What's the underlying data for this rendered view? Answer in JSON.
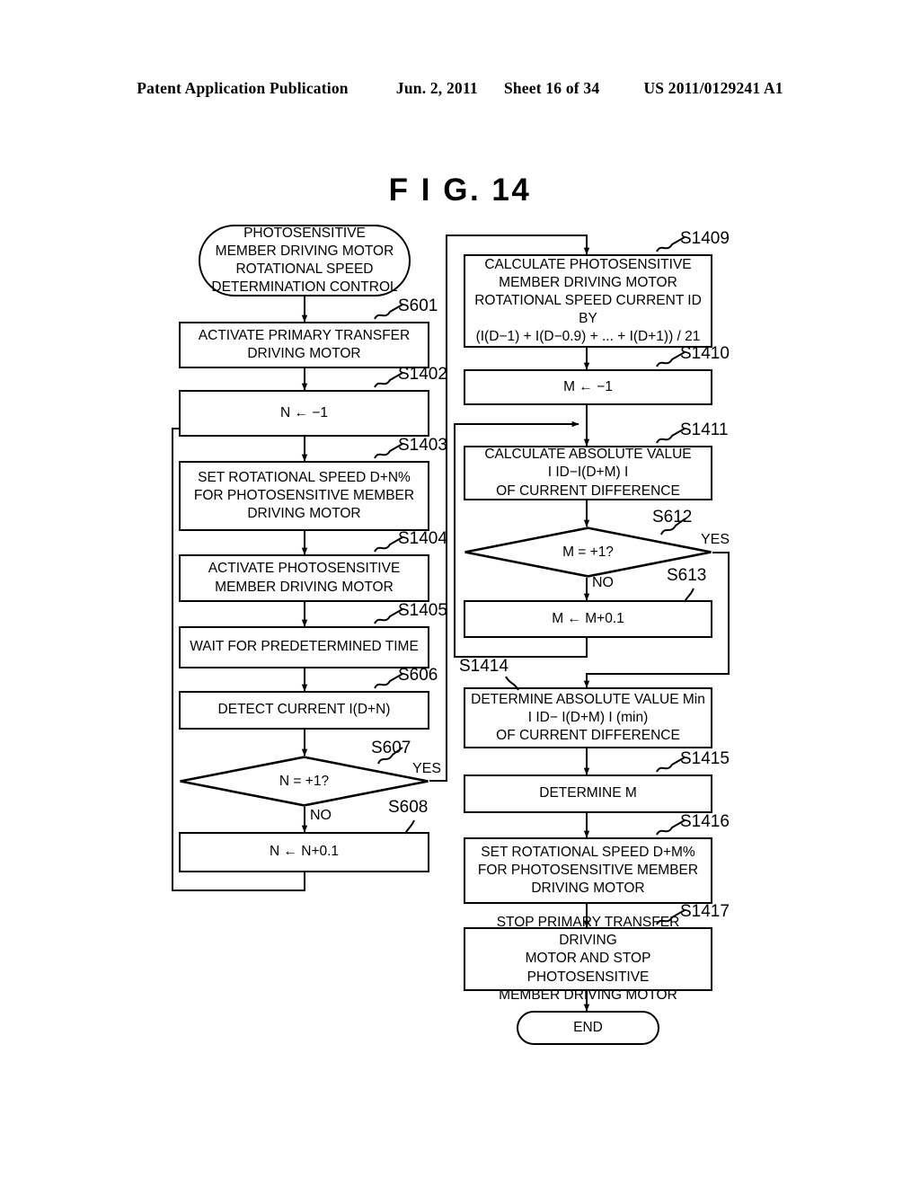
{
  "header": {
    "publication": "Patent Application Publication",
    "date": "Jun. 2, 2011",
    "sheet": "Sheet 16 of 34",
    "number": "US 2011/0129241 A1"
  },
  "figure": {
    "title": "F I G.  14"
  },
  "flowchart": {
    "start": {
      "id": "start",
      "label": "PHOTOSENSITIVE\nMEMBER DRIVING MOTOR\nROTATIONAL SPEED\nDETERMINATION CONTROL"
    },
    "end": {
      "id": "end",
      "label": "END"
    },
    "steps": [
      {
        "ref": "S601",
        "type": "process",
        "label": "ACTIVATE PRIMARY TRANSFER\nDRIVING MOTOR"
      },
      {
        "ref": "S1402",
        "type": "process",
        "label": "N ← −1"
      },
      {
        "ref": "S1403",
        "type": "process",
        "label": "SET ROTATIONAL SPEED D+N%\nFOR PHOTOSENSITIVE MEMBER\nDRIVING MOTOR"
      },
      {
        "ref": "S1404",
        "type": "process",
        "label": "ACTIVATE PHOTOSENSITIVE\nMEMBER DRIVING MOTOR"
      },
      {
        "ref": "S1405",
        "type": "process",
        "label": "WAIT FOR PREDETERMINED TIME"
      },
      {
        "ref": "S606",
        "type": "process",
        "label": "DETECT CURRENT I(D+N)"
      },
      {
        "ref": "S607",
        "type": "decision",
        "label": "N = +1?",
        "yes": "YES",
        "no": "NO"
      },
      {
        "ref": "S608",
        "type": "process",
        "label": "N ← N+0.1"
      },
      {
        "ref": "S1409",
        "type": "process",
        "label": "CALCULATE PHOTOSENSITIVE\nMEMBER DRIVING MOTOR\nROTATIONAL SPEED CURRENT ID BY\n(I(D−1) + I(D−0.9) + ... + I(D+1)) / 21"
      },
      {
        "ref": "S1410",
        "type": "process",
        "label": "M ← −1"
      },
      {
        "ref": "S1411",
        "type": "process",
        "label": "CALCULATE ABSOLUTE VALUE\nI ID−I(D+M) I\nOF CURRENT DIFFERENCE"
      },
      {
        "ref": "S612",
        "type": "decision",
        "label": "M = +1?",
        "yes": "YES",
        "no": "NO"
      },
      {
        "ref": "S613",
        "type": "process",
        "label": "M ← M+0.1"
      },
      {
        "ref": "S1414",
        "type": "process",
        "label": "DETERMINE ABSOLUTE VALUE Min\nI ID− I(D+M) I (min)\nOF CURRENT DIFFERENCE"
      },
      {
        "ref": "S1415",
        "type": "process",
        "label": "DETERMINE M"
      },
      {
        "ref": "S1416",
        "type": "process",
        "label": "SET ROTATIONAL SPEED D+M%\nFOR PHOTOSENSITIVE MEMBER\nDRIVING MOTOR"
      },
      {
        "ref": "S1417",
        "type": "process",
        "label": "STOP PRIMARY TRANSFER DRIVING\nMOTOR AND STOP PHOTOSENSITIVE\nMEMBER DRIVING MOTOR"
      }
    ]
  }
}
